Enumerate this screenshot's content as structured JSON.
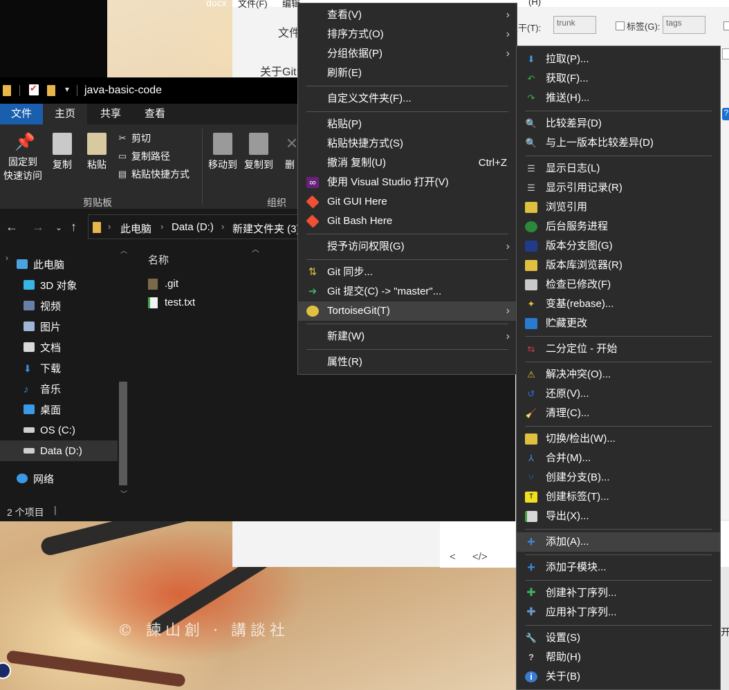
{
  "background_editor": {
    "menu_items": [
      "文件(F)",
      "编辑",
      "(H)"
    ],
    "labels": [
      "文件",
      "关于Git",
      "主干(T):",
      "标签(G):"
    ],
    "trunk_value": "trunk",
    "tags_value": "tags",
    "nav_left": "<",
    "nav_code": "</>",
    "corner_text": "开",
    "top_left_text": "docx"
  },
  "wallpaper": {
    "copyright": "© 諫山創 · 講談社"
  },
  "explorer": {
    "title": "java-basic-code",
    "tabs": [
      "文件",
      "主页",
      "共享",
      "查看"
    ],
    "ribbon": {
      "pin_label": "固定到\n快速访问",
      "copy_label": "复制",
      "paste_label": "粘贴",
      "cut_label": "剪切",
      "copy_path_label": "复制路径",
      "paste_shortcut_label": "粘贴快捷方式",
      "move_to_label": "移动到",
      "copy_to_label": "复制到",
      "delete_label": "删",
      "clipboard_group": "剪贴板",
      "organize_group": "组织"
    },
    "address": {
      "crumbs": [
        "此电脑",
        "Data (D:)",
        "新建文件夹 (3)"
      ]
    },
    "nav": [
      {
        "label": "此电脑",
        "icon": "computer-icon",
        "color": "#4aa3df"
      },
      {
        "label": "3D 对象",
        "icon": "cube-icon",
        "color": "#39b4e6"
      },
      {
        "label": "视频",
        "icon": "video-icon",
        "color": "#6a7fa8"
      },
      {
        "label": "图片",
        "icon": "picture-icon",
        "color": "#9fb7d6"
      },
      {
        "label": "文档",
        "icon": "document-icon",
        "color": "#d9d9d9"
      },
      {
        "label": "下载",
        "icon": "download-icon",
        "color": "#3a8fe0"
      },
      {
        "label": "音乐",
        "icon": "music-icon",
        "color": "#3a8fe0"
      },
      {
        "label": "桌面",
        "icon": "desktop-icon",
        "color": "#3a9ae8"
      },
      {
        "label": "OS (C:)",
        "icon": "drive-icon",
        "color": "#cfcfcf"
      },
      {
        "label": "Data (D:)",
        "icon": "drive-icon",
        "color": "#cfcfcf"
      },
      {
        "label": "网络",
        "icon": "network-icon",
        "color": "#3a9ae8"
      }
    ],
    "column_name": "名称",
    "files": [
      {
        "name": ".git",
        "icon": "folder-icon"
      },
      {
        "name": "test.txt",
        "icon": "text-file-icon"
      }
    ],
    "status": "2 个项目"
  },
  "context_menu": {
    "items": [
      {
        "label": "查看(V)",
        "submenu": true
      },
      {
        "label": "排序方式(O)",
        "submenu": true
      },
      {
        "label": "分组依据(P)",
        "submenu": true
      },
      {
        "label": "刷新(E)"
      },
      {
        "label": "自定义文件夹(F)..."
      },
      {
        "label": "粘贴(P)"
      },
      {
        "label": "粘贴快捷方式(S)"
      },
      {
        "label": "撤消 复制(U)",
        "shortcut": "Ctrl+Z"
      },
      {
        "label": "使用 Visual Studio 打开(V)"
      },
      {
        "label": "Git GUI Here"
      },
      {
        "label": "Git Bash Here"
      },
      {
        "label": "授予访问权限(G)",
        "submenu": true
      },
      {
        "label": "Git 同步..."
      },
      {
        "label": "Git 提交(C) -> \"master\"..."
      },
      {
        "label": "TortoiseGit(T)",
        "submenu": true
      },
      {
        "label": "新建(W)",
        "submenu": true
      },
      {
        "label": "属性(R)"
      }
    ]
  },
  "tortoise_menu": {
    "items": [
      {
        "label": "拉取(P)...",
        "icon": "pull-icon"
      },
      {
        "label": "获取(F)...",
        "icon": "fetch-icon"
      },
      {
        "label": "推送(H)...",
        "icon": "push-icon"
      },
      {
        "label": "比较差异(D)",
        "icon": "diff-icon"
      },
      {
        "label": "与上一版本比较差异(D)",
        "icon": "diff-prev-icon"
      },
      {
        "label": "显示日志(L)",
        "icon": "log-icon"
      },
      {
        "label": "显示引用记录(R)",
        "icon": "reflog-icon"
      },
      {
        "label": "浏览引用",
        "icon": "browse-refs-icon"
      },
      {
        "label": "后台服务进程",
        "icon": "globe-icon"
      },
      {
        "label": "版本分支图(G)",
        "icon": "revision-graph-icon"
      },
      {
        "label": "版本库浏览器(R)",
        "icon": "repo-browser-icon"
      },
      {
        "label": "检查已修改(F)",
        "icon": "check-modifications-icon"
      },
      {
        "label": "变基(rebase)...",
        "icon": "rebase-icon"
      },
      {
        "label": "贮藏更改",
        "icon": "stash-icon"
      },
      {
        "label": "二分定位 - 开始",
        "icon": "bisect-icon"
      },
      {
        "label": "解决冲突(O)...",
        "icon": "resolve-icon"
      },
      {
        "label": "还原(V)...",
        "icon": "revert-icon"
      },
      {
        "label": "清理(C)...",
        "icon": "cleanup-icon"
      },
      {
        "label": "切换/检出(W)...",
        "icon": "switch-icon"
      },
      {
        "label": "合并(M)...",
        "icon": "merge-icon"
      },
      {
        "label": "创建分支(B)...",
        "icon": "branch-icon"
      },
      {
        "label": "创建标签(T)...",
        "icon": "tag-icon"
      },
      {
        "label": "导出(X)...",
        "icon": "export-icon"
      },
      {
        "label": "添加(A)...",
        "icon": "add-icon"
      },
      {
        "label": "添加子模块...",
        "icon": "add-submodule-icon"
      },
      {
        "label": "创建补丁序列...",
        "icon": "create-patch-icon"
      },
      {
        "label": "应用补丁序列...",
        "icon": "apply-patch-icon"
      },
      {
        "label": "设置(S)",
        "icon": "wrench-icon"
      },
      {
        "label": "帮助(H)",
        "icon": "help-icon"
      },
      {
        "label": "关于(B)",
        "icon": "info-icon"
      }
    ]
  }
}
